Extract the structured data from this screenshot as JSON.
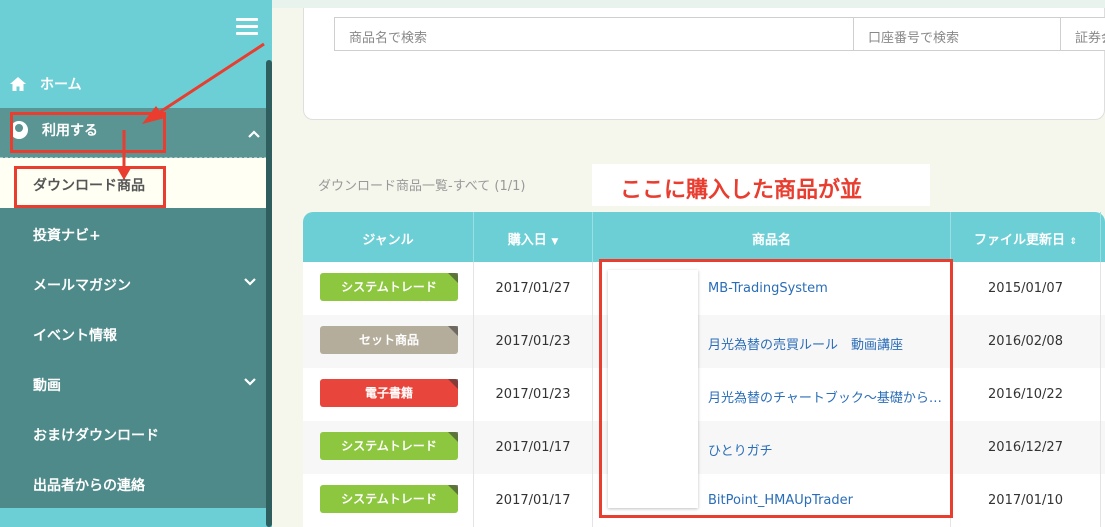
{
  "sidebar": {
    "home_label": "ホーム",
    "riyou_label": "利用する",
    "active_item": "ダウンロード商品",
    "items": [
      {
        "label": "投資ナビ+",
        "chevron": false
      },
      {
        "label": "メールマガジン",
        "chevron": true
      },
      {
        "label": "イベント情報",
        "chevron": false
      },
      {
        "label": "動画",
        "chevron": true
      },
      {
        "label": "おまけダウンロード",
        "chevron": false
      },
      {
        "label": "出品者からの連絡",
        "chevron": false
      }
    ]
  },
  "search": {
    "product_placeholder": "商品名で検索",
    "account_placeholder": "口座番号で検索",
    "broker_placeholder": "証券会"
  },
  "list_title": "ダウンロード商品一覧-すべて (1/1)",
  "annotation_text": "ここに購入した商品が並",
  "table": {
    "headers": {
      "genre": "ジャンル",
      "purchase_date": "購入日",
      "product_name": "商品名",
      "file_updated": "ファイル更新日"
    },
    "rows": [
      {
        "genre": "システムトレード",
        "genre_color": "#8dc63f",
        "purchase_date": "2017/01/27",
        "name": "MB-TradingSystem",
        "updated": "2015/01/07"
      },
      {
        "genre": "セット商品",
        "genre_color": "#b5ad9c",
        "purchase_date": "2017/01/23",
        "name": "月光為替の売買ルール　動画講座",
        "updated": "2016/02/08"
      },
      {
        "genre": "電子書籍",
        "genre_color": "#e8453c",
        "purchase_date": "2017/01/23",
        "name": "月光為替のチャートブック～基礎から…",
        "updated": "2016/10/22"
      },
      {
        "genre": "システムトレード",
        "genre_color": "#8dc63f",
        "purchase_date": "2017/01/17",
        "name": "ひとりガチ",
        "updated": "2016/12/27"
      },
      {
        "genre": "システムトレード",
        "genre_color": "#8dc63f",
        "purchase_date": "2017/01/17",
        "name": "BitPoint_HMAUpTrader",
        "updated": "2017/01/10"
      }
    ]
  },
  "colors": {
    "accent": "#6ccfd6",
    "sidebar": "#4e8a89",
    "annotation": "#e83d2f",
    "link": "#2a6db8"
  }
}
